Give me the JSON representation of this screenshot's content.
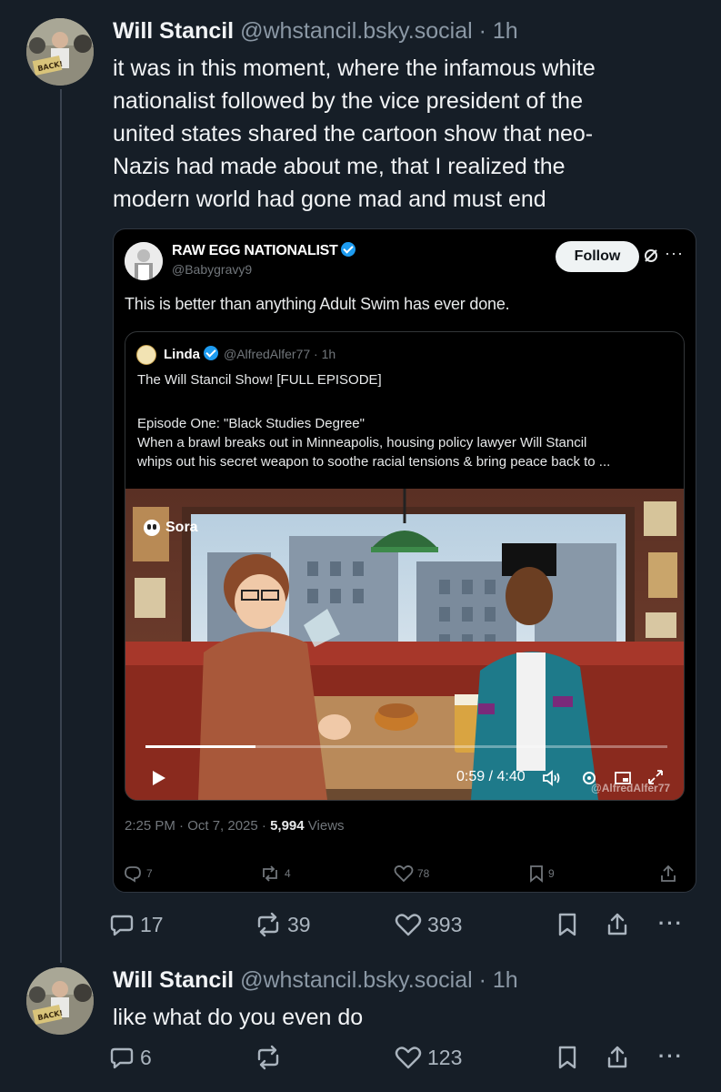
{
  "post1": {
    "name": "Will Stancil",
    "handle": "@whstancil.bsky.social",
    "time": "· 1h",
    "text_lines": [
      "it was in this moment, where the infamous white",
      "nationalist followed by the vice president of the",
      "united states shared the cartoon show that neo-",
      "Nazis had made about me, that I realized the",
      "modern world had gone mad and must end"
    ],
    "avatar_sign": "BACK!",
    "actions": {
      "replies": "17",
      "reposts": "39",
      "likes": "393"
    }
  },
  "embed": {
    "name": "RAW EGG NATIONALIST",
    "handle": "@Babygravy9",
    "follow_label": "Follow",
    "more": "···",
    "text": "This is better than anything Adult Swim has ever done.",
    "quote": {
      "name": "Linda",
      "handle": "@AlfredAlfer77 · 1h",
      "title": "The Will Stancil Show! [FULL EPISODE]",
      "body_line1": "Episode One: \"Black Studies Degree\"",
      "body_line2": "When a brawl breaks out in Minneapolis, housing policy lawyer Will Stancil",
      "body_line3": "whips out his secret weapon to soothe racial tensions & bring peace back to ...",
      "video": {
        "watermark_label": "Sora",
        "time": "0:59 / 4:40",
        "progress": 0.21,
        "corner_watermark": "@AlfredAlfer77"
      }
    },
    "meta_time": "2:25 PM · Oct 7, 2025 · ",
    "meta_views_count": "5,994",
    "meta_views_label": " Views",
    "actions": {
      "replies": "7",
      "reposts": "4",
      "likes": "78",
      "bookmarks": "9"
    }
  },
  "post2": {
    "name": "Will Stancil",
    "handle": "@whstancil.bsky.social",
    "time": "· 1h",
    "text": "like what do you even do",
    "avatar_sign": "BACK!",
    "actions": {
      "replies": "6",
      "likes": "123"
    }
  },
  "colors": {
    "background": "#161e27",
    "text": "#f1f3f5",
    "muted": "#8b98a5",
    "verified": "#1d9bf0"
  }
}
